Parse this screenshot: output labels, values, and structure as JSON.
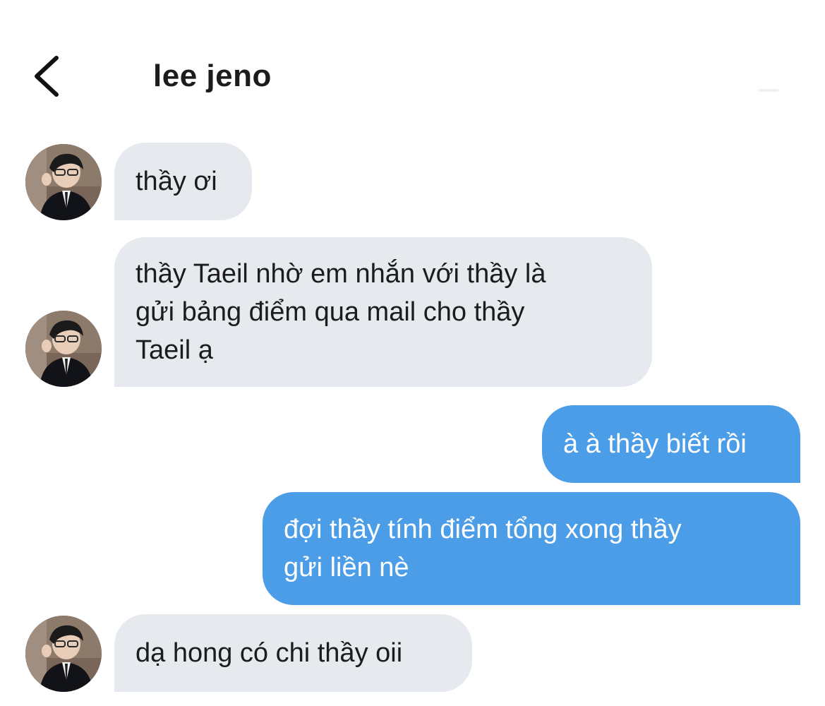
{
  "header": {
    "back_icon": "chevron-left-icon",
    "title": "lee jeno"
  },
  "messages": [
    {
      "direction": "incoming",
      "text": "thầy ơi"
    },
    {
      "direction": "incoming",
      "text": "thầy Taeil nhờ em nhắn với thầy là\ngửi bảng điểm qua mail cho thầy\nTaeil ạ"
    },
    {
      "direction": "outgoing",
      "text": "à à thầy biết rồi"
    },
    {
      "direction": "outgoing",
      "text": "đợi thầy tính điểm tổng xong thầy\ngửi liền nè"
    },
    {
      "direction": "incoming",
      "text": "dạ hong có chi thầy oii"
    }
  ],
  "colors": {
    "incoming_bubble": "#e6eaee",
    "outgoing_bubble": "#4c9de8",
    "outgoing_text": "#ffffff",
    "text": "#1c1c1e"
  }
}
